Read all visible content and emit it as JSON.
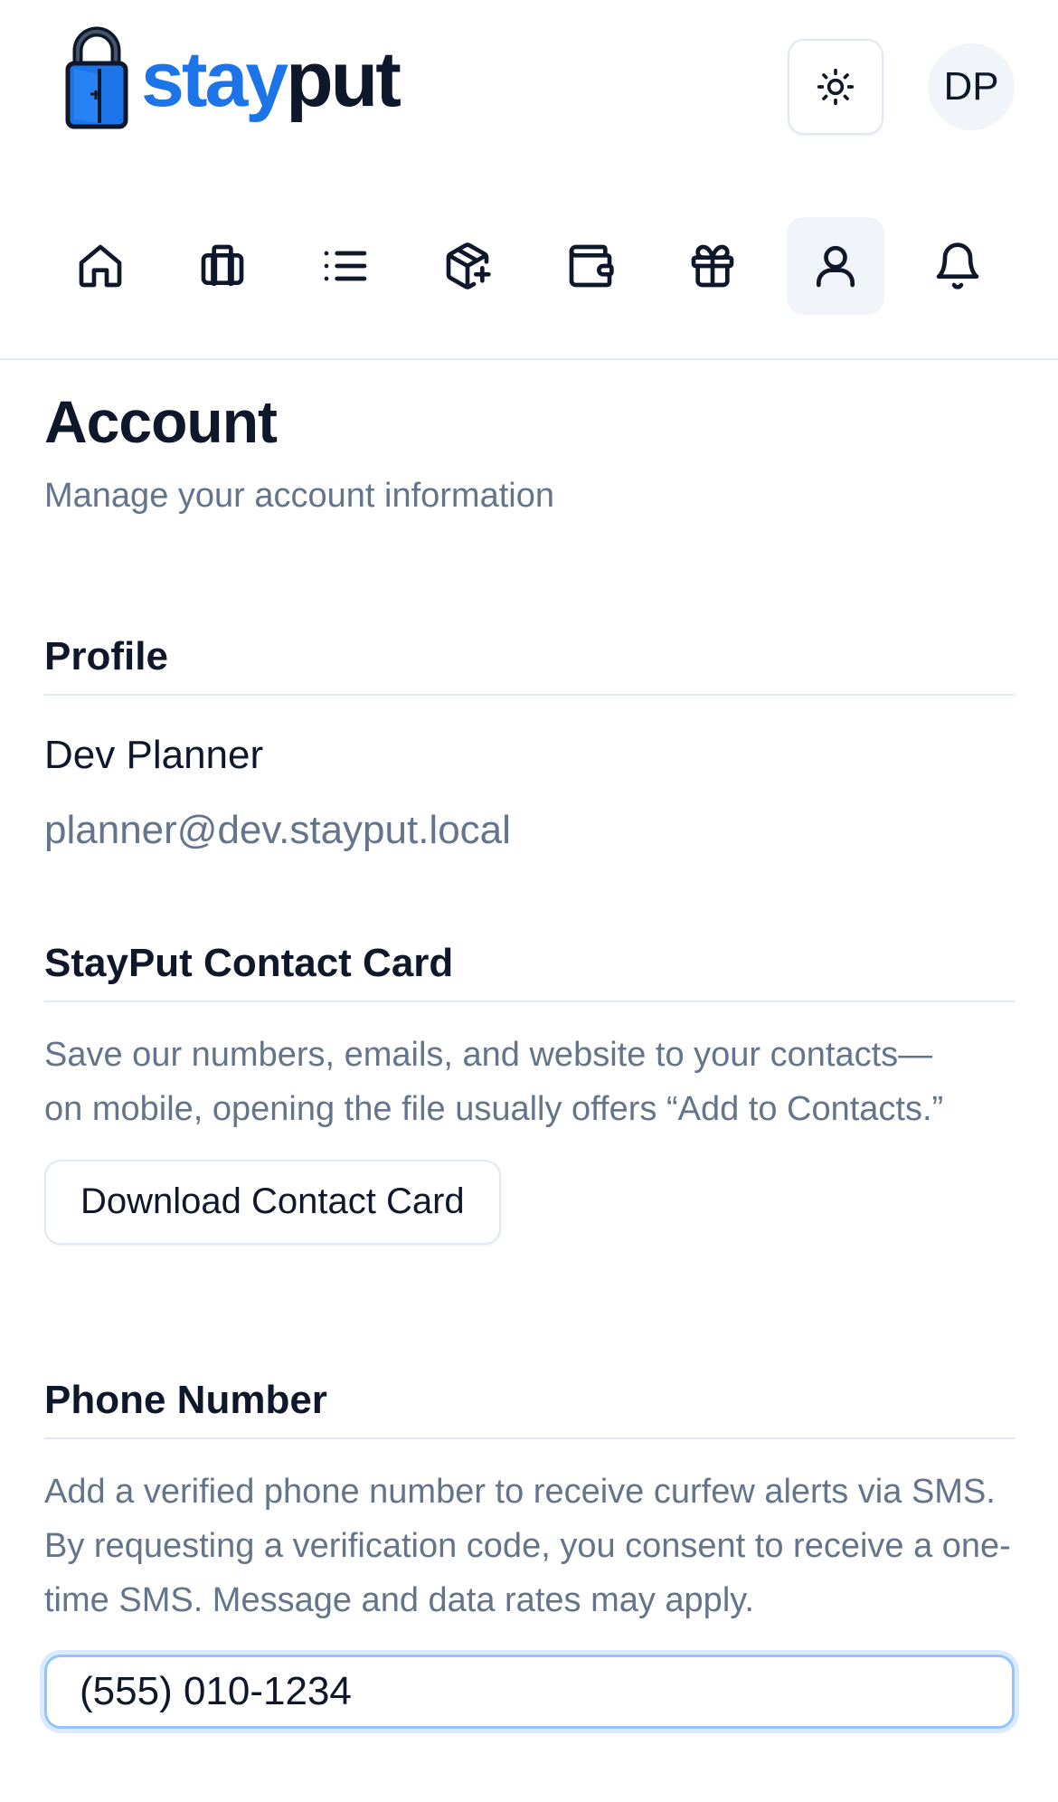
{
  "brand": {
    "name_part1": "stay",
    "name_part2": "put",
    "accent_color": "#1d74e8"
  },
  "header": {
    "theme_toggle_icon": "sun-icon",
    "avatar_initials": "DP"
  },
  "nav": {
    "items": [
      {
        "icon": "home-icon",
        "active": false
      },
      {
        "icon": "luggage-icon",
        "active": false
      },
      {
        "icon": "list-icon",
        "active": false
      },
      {
        "icon": "package-plus-icon",
        "active": false
      },
      {
        "icon": "wallet-icon",
        "active": false
      },
      {
        "icon": "gift-icon",
        "active": false
      },
      {
        "icon": "user-icon",
        "active": true
      },
      {
        "icon": "bell-icon",
        "active": false
      }
    ]
  },
  "page": {
    "title": "Account",
    "subtitle": "Manage your account information"
  },
  "profile": {
    "heading": "Profile",
    "name": "Dev Planner",
    "email": "planner@dev.stayput.local"
  },
  "contact_card": {
    "heading": "StayPut Contact Card",
    "description": "Save our numbers, emails, and website to your contacts—on mobile, opening the file usually offers “Add to Contacts.”",
    "button_label": "Download Contact Card"
  },
  "phone": {
    "heading": "Phone Number",
    "description": "Add a verified phone number to receive curfew alerts via SMS. By requesting a verification code, you consent to receive a one-time SMS. Message and data rates may apply.",
    "input_value": "(555) 010-1234"
  }
}
